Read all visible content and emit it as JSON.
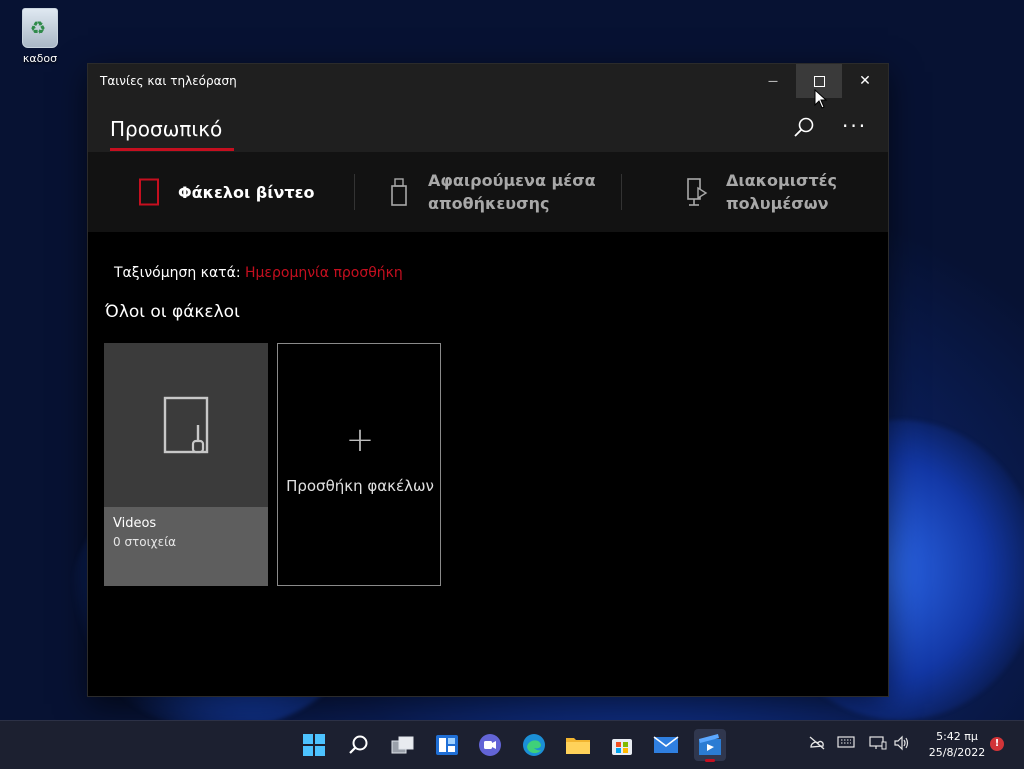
{
  "desktop": {
    "recycle_bin_label": "καδοσ"
  },
  "window": {
    "title": "Ταινίες και τηλεόραση",
    "controls": {
      "minimize_glyph": "—",
      "close_glyph": "✕"
    }
  },
  "header": {
    "active_tab": "Προσωπικό",
    "more_glyph": "···"
  },
  "nav": {
    "items": [
      {
        "line1": "Φάκελοι βίντεο",
        "line2": "",
        "icon": "video-folder-icon",
        "active": true
      },
      {
        "line1": "Αφαιρούμενα μέσα",
        "line2": "αποθήκευσης",
        "icon": "usb-drive-icon",
        "active": false
      },
      {
        "line1": "Διακομιστές",
        "line2": "πολυμέσων",
        "icon": "media-server-icon",
        "active": false
      }
    ]
  },
  "content": {
    "sort_label": "Ταξινόμηση κατά:",
    "sort_value": "Ημερομηνία προσθήκη",
    "section_title": "Όλοι οι φάκελοι",
    "folders": [
      {
        "name": "Videos",
        "count": "0 στοιχεία"
      }
    ],
    "add_tile": {
      "plus": "+",
      "label": "Προσθήκη φακέλων"
    }
  },
  "taskbar": {
    "clock_time": "5:42 πμ",
    "clock_date": "25/8/2022",
    "notification_badge": "!",
    "accent_color": "#c50f1f"
  }
}
